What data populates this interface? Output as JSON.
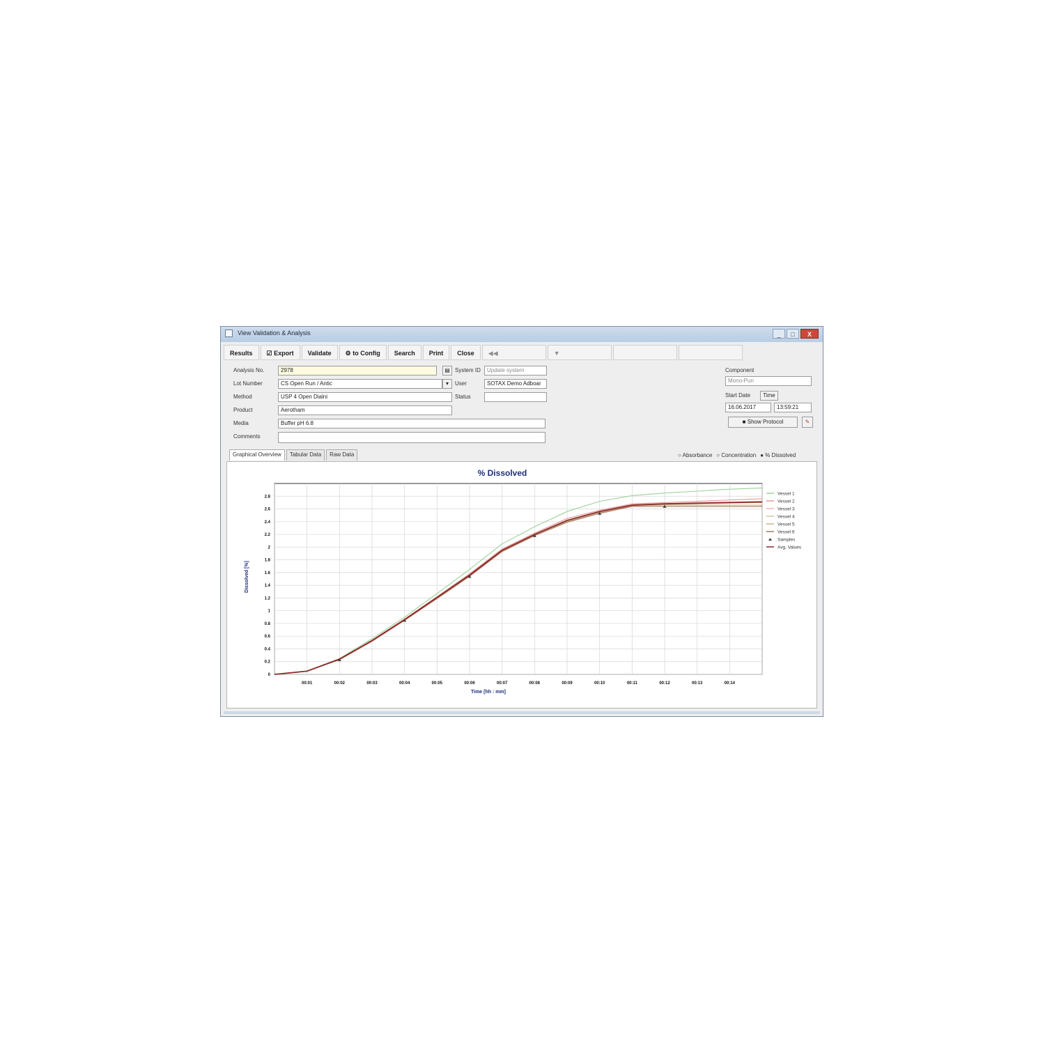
{
  "window": {
    "title": "View Validation & Analysis",
    "controls": [
      "_",
      "□",
      "X"
    ]
  },
  "toolbar": {
    "results_label": "Results",
    "export_label": "Export",
    "validate_label": "Validate",
    "config_label": "to Config",
    "search_label": "Search",
    "print_label": "Print",
    "close_label": "Close",
    "dim_labels": [
      "◀◀",
      "▼",
      "",
      ""
    ]
  },
  "form": {
    "analysis_no_label": "Analysis No.",
    "analysis_no": "2978",
    "lot_number_label": "Lot Number",
    "lot_number": "CS Open Run / Antic",
    "method_label": "Method",
    "method": "USP 4 Open Dialni",
    "product_label": "Product",
    "product": "Aerotham",
    "media_label": "Media",
    "media": "Buffer pH 6.8",
    "comments_label": "Comments",
    "comments": "",
    "system_id_label": "System ID",
    "system_id": "Update system",
    "user_label": "User",
    "user": "SOTAX Demo Adboar",
    "status_label": "Status",
    "status": "",
    "component_label": "Component",
    "component": "Mono-Pun",
    "start_date_label": "Start Date",
    "time_label": "Time",
    "start_date": "16.06.2017",
    "start_time": "13:59:21",
    "show_protocol_label": "Show Protocol"
  },
  "tabs": [
    "Graphical Overview",
    "Tabular Data",
    "Raw Data"
  ],
  "display_options": [
    "Absorbance",
    "Concentration",
    "% Dissolved"
  ],
  "chart_data": {
    "type": "line",
    "title": "% Dissolved",
    "xlabel": "Time [hh : mm]",
    "ylabel": "Dissolved [%]",
    "categories": [
      "",
      "00:01",
      "00:02",
      "00:03",
      "00:04",
      "00:05",
      "00:06",
      "00:07",
      "00:08",
      "00:09",
      "00:10",
      "00:11",
      "00:12",
      "00:13",
      "00:14",
      ""
    ],
    "ylim": [
      0,
      3.0
    ],
    "yticks": [
      "0",
      "0.2",
      "0.4",
      "0.6",
      "0.8",
      "1",
      "1.2",
      "1.4",
      "1.6",
      "1.8",
      "2",
      "2.2",
      "2.4",
      "2.6",
      "2.8"
    ],
    "grid": true,
    "legend_position": "right",
    "series": [
      {
        "name": "Vessel 1",
        "color": "#9bd29b",
        "values": [
          0,
          0.05,
          0.25,
          0.56,
          0.9,
          1.27,
          1.65,
          2.05,
          2.32,
          2.56,
          2.72,
          2.81,
          2.85,
          2.88,
          2.91,
          2.93
        ]
      },
      {
        "name": "Vessel 2",
        "color": "#e59a9a",
        "values": [
          0,
          0.05,
          0.24,
          0.54,
          0.87,
          1.22,
          1.58,
          1.97,
          2.22,
          2.45,
          2.58,
          2.68,
          2.7,
          2.72,
          2.74,
          2.76
        ]
      },
      {
        "name": "Vessel 3",
        "color": "#f0b6b6",
        "values": [
          0,
          0.05,
          0.24,
          0.53,
          0.86,
          1.21,
          1.56,
          1.95,
          2.2,
          2.42,
          2.56,
          2.67,
          2.68,
          2.7,
          2.71,
          2.72
        ]
      },
      {
        "name": "Vessel 4",
        "color": "#d8c3a0",
        "values": [
          0,
          0.05,
          0.24,
          0.53,
          0.86,
          1.2,
          1.55,
          1.95,
          2.19,
          2.41,
          2.55,
          2.66,
          2.67,
          2.68,
          2.69,
          2.7
        ]
      },
      {
        "name": "Vessel 5",
        "color": "#c7b38a",
        "values": [
          0,
          0.05,
          0.24,
          0.53,
          0.85,
          1.2,
          1.55,
          1.94,
          2.19,
          2.4,
          2.54,
          2.65,
          2.66,
          2.66,
          2.66,
          2.66
        ]
      },
      {
        "name": "Vessel 6",
        "color": "#a47a5c",
        "values": [
          0,
          0.05,
          0.23,
          0.52,
          0.85,
          1.19,
          1.54,
          1.93,
          2.18,
          2.39,
          2.53,
          2.64,
          2.64,
          2.64,
          2.64,
          2.64
        ]
      },
      {
        "name": "Samples",
        "color": "#444444",
        "values": [
          null,
          null,
          0.23,
          null,
          0.85,
          null,
          1.54,
          null,
          2.18,
          null,
          2.53,
          null,
          2.64,
          null,
          null,
          null
        ]
      },
      {
        "name": "Avg. Values",
        "color": "#8b2a2a",
        "values": [
          0,
          0.05,
          0.24,
          0.53,
          0.86,
          1.21,
          1.56,
          1.95,
          2.2,
          2.42,
          2.56,
          2.66,
          2.68,
          2.69,
          2.7,
          2.71
        ]
      }
    ]
  }
}
